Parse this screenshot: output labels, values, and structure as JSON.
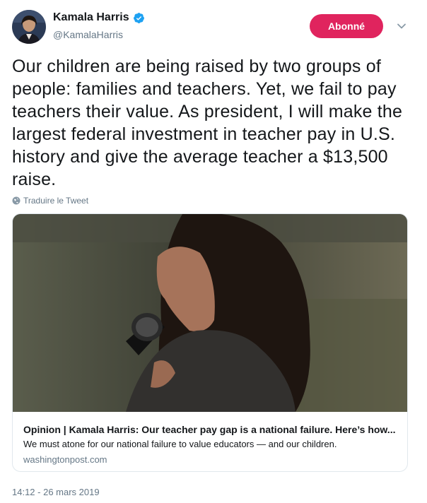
{
  "author": {
    "name": "Kamala Harris",
    "handle": "@KamalaHarris",
    "verified": true
  },
  "follow_button": {
    "label": "Abonné",
    "color": "#e0245e"
  },
  "tweet": {
    "text": "Our children are being raised by two groups of people: families and teachers. Yet, we fail to pay teachers their value. As president, I will make the largest federal investment in teacher pay in U.S. history and give the average teacher a $13,500 raise.",
    "translate_label": "Traduire le Tweet",
    "timestamp": "14:12 - 26 mars 2019"
  },
  "link_card": {
    "title": "Opinion | Kamala Harris: Our teacher pay gap is a national failure. Here’s how...",
    "description": "We must atone for our national failure to value educators — and our children.",
    "domain": "washingtonpost.com"
  },
  "colors": {
    "verified_blue": "#1da1f2",
    "secondary_text": "#657786"
  }
}
